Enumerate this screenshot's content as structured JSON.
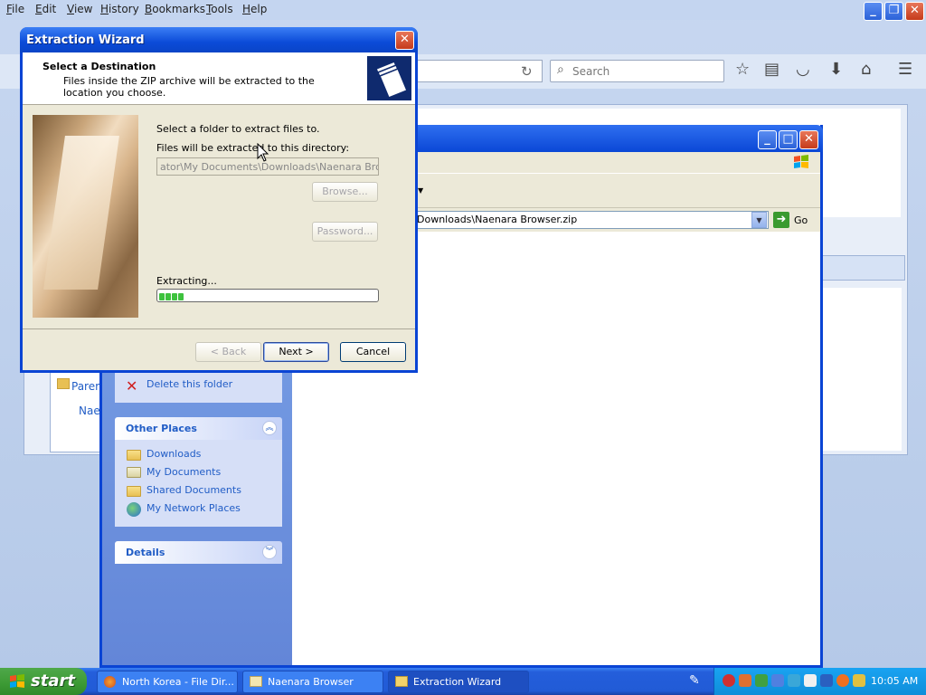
{
  "browser": {
    "menu": [
      {
        "label": "File",
        "key": "F"
      },
      {
        "label": "Edit",
        "key": "E"
      },
      {
        "label": "View",
        "key": "V"
      },
      {
        "label": "History",
        "key": "H"
      },
      {
        "label": "Bookmarks",
        "key": "B"
      },
      {
        "label": "Tools",
        "key": "T"
      },
      {
        "label": "Help",
        "key": "H"
      }
    ],
    "search_placeholder": "Search"
  },
  "explorer": {
    "address": "Downloads\\Naenara Browser.zip",
    "go_label": "Go",
    "file_folder_tasks": {
      "delete_label": "Delete this folder"
    },
    "other_places": {
      "title": "Other Places",
      "items": [
        "Downloads",
        "My Documents",
        "Shared Documents",
        "My Network Places"
      ]
    },
    "details": {
      "title": "Details"
    },
    "behind_dialog": {
      "line1": "Parer",
      "line2": "Nae"
    }
  },
  "wizard": {
    "title": "Extraction Wizard",
    "heading": "Select a Destination",
    "subheading": "Files inside the ZIP archive will be extracted to the location you choose.",
    "select_label": "Select a folder to extract files to.",
    "dir_label": "Files will be extracted to this directory:",
    "path_value": "ator\\My Documents\\Downloads\\Naenara Browser",
    "browse_label": "Browse...",
    "password_label": "Password...",
    "extracting_label": "Extracting...",
    "progress_segments": 4,
    "back_label": "< Back",
    "next_label": "Next >",
    "cancel_label": "Cancel"
  },
  "taskbar": {
    "start_label": "start",
    "tasks": [
      {
        "label": "North Korea - File Dir..."
      },
      {
        "label": "Naenara Browser"
      },
      {
        "label": "Extraction Wizard"
      }
    ],
    "clock": "10:05 AM"
  },
  "colors": {
    "xp_blue": "#0a44d4",
    "task_link": "#215dc6",
    "start_green": "#3c9a34",
    "progress_green": "#3ec23e"
  }
}
